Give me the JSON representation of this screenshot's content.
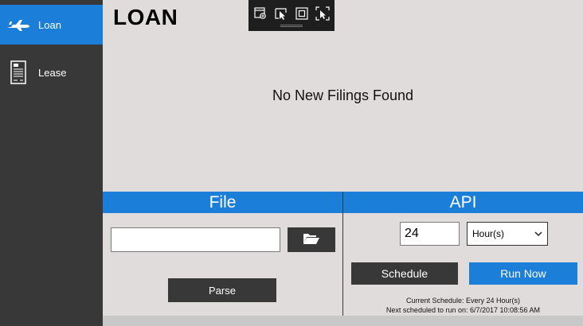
{
  "sidebar": {
    "items": [
      {
        "label": "Loan",
        "icon": "airplane-icon",
        "active": true
      },
      {
        "label": "Lease",
        "icon": "document-icon",
        "active": false
      }
    ]
  },
  "main": {
    "title": "LOAN",
    "empty_message": "No New Filings Found"
  },
  "debug_toolbar": {
    "icons": [
      "live-visual-tree-icon",
      "select-element-icon",
      "display-layout-adorners-icon",
      "track-focus-icon"
    ]
  },
  "file_panel": {
    "header": "File",
    "file_path_value": "",
    "browse_icon": "folder-open-icon",
    "parse_label": "Parse"
  },
  "api_panel": {
    "header": "API",
    "interval_value": "24",
    "unit_selected": "Hour(s)",
    "schedule_label": "Schedule",
    "run_now_label": "Run Now",
    "current_schedule": "Current Schedule: Every 24 Hour(s)",
    "next_run": "Next scheduled to run on: 6/7/2017 10:08:56 AM"
  },
  "colors": {
    "accent": "#1b7fd9",
    "sidebar": "#383838",
    "background": "#e0dcdc",
    "button_dark": "#383838"
  }
}
